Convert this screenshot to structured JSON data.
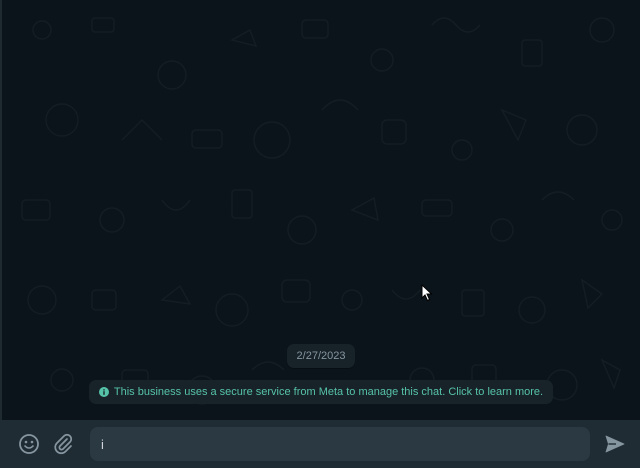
{
  "chat": {
    "date_separator": "2/27/2023",
    "system_notice": "This business uses a secure service from Meta to manage this chat. Click to learn more."
  },
  "composer": {
    "input_value": "i",
    "emoji_icon": "smiley-icon",
    "attach_icon": "paperclip-icon",
    "send_icon": "send-icon"
  },
  "colors": {
    "chat_background": "#0b141a",
    "footer_background": "#202c33",
    "input_background": "#2a3942",
    "notice_text": "#56c3a8",
    "chip_background": "#182229"
  }
}
